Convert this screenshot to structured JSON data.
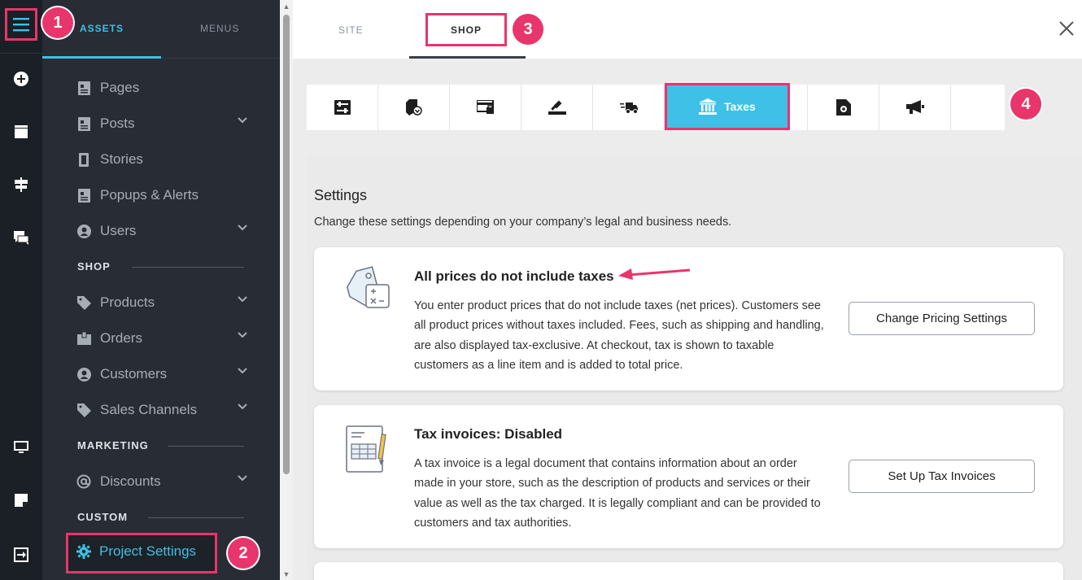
{
  "rail": {
    "icons": [
      "menu-icon",
      "add-icon",
      "archive-icon",
      "signpost-icon",
      "chat-icon",
      "monitor-icon",
      "sticky-note-icon",
      "logout-icon"
    ]
  },
  "nav": {
    "tabs": {
      "assets": "ASSETS",
      "menus": "MENUS"
    },
    "items": [
      {
        "label": "Pages",
        "icon": "page-icon"
      },
      {
        "label": "Posts",
        "icon": "page-icon",
        "expandable": true
      },
      {
        "label": "Stories",
        "icon": "story-icon"
      },
      {
        "label": "Popups & Alerts",
        "icon": "page-icon"
      },
      {
        "label": "Users",
        "icon": "user-icon",
        "expandable": true
      }
    ],
    "shop_section": "SHOP",
    "shop_items": [
      {
        "label": "Products",
        "icon": "tag-icon",
        "expandable": true
      },
      {
        "label": "Orders",
        "icon": "box-icon",
        "expandable": true
      },
      {
        "label": "Customers",
        "icon": "user-icon",
        "expandable": true
      },
      {
        "label": "Sales Channels",
        "icon": "tag-icon",
        "expandable": true
      }
    ],
    "marketing_section": "MARKETING",
    "marketing_items": [
      {
        "label": "Discounts",
        "icon": "at-icon",
        "expandable": true
      }
    ],
    "custom_section": "CUSTOM",
    "project_settings": "Project Settings"
  },
  "badges": {
    "b1": "1",
    "b2": "2",
    "b3": "3",
    "b4": "4"
  },
  "top": {
    "site": "SITE",
    "shop": "SHOP"
  },
  "toolbar": {
    "active_label": "Taxes",
    "buttons": [
      "settings-sliders-icon",
      "download-tag-icon",
      "payment-card-icon",
      "auction-icon",
      "shipping-truck-icon",
      "bank-icon",
      "receipt-icon",
      "document-settings-icon",
      "megaphone-icon"
    ]
  },
  "settings": {
    "heading": "Settings",
    "subtitle": "Change these settings depending on your company’s legal and business needs."
  },
  "cards": [
    {
      "title": "All prices do not include taxes",
      "desc": "You enter product prices that do not include taxes (net prices). Customers see all product prices without taxes included. Fees, such as shipping and handling, are also displayed tax-exclusive. At checkout, tax is shown to taxable customers as a line item and is added to total price.",
      "button": "Change Pricing Settings"
    },
    {
      "title": "Tax invoices: Disabled",
      "desc": "A tax invoice is a legal document that contains information about an order made in your store, such as the description of products and services or their value as well as the tax charged. It is legally compliant and can be provided to customers and tax authorities.",
      "button": "Set Up Tax Invoices"
    }
  ],
  "colors": {
    "accent": "#3fc0e6",
    "highlight": "#e8356b",
    "sidebar": "#272c35",
    "rail": "#1b1f26"
  }
}
